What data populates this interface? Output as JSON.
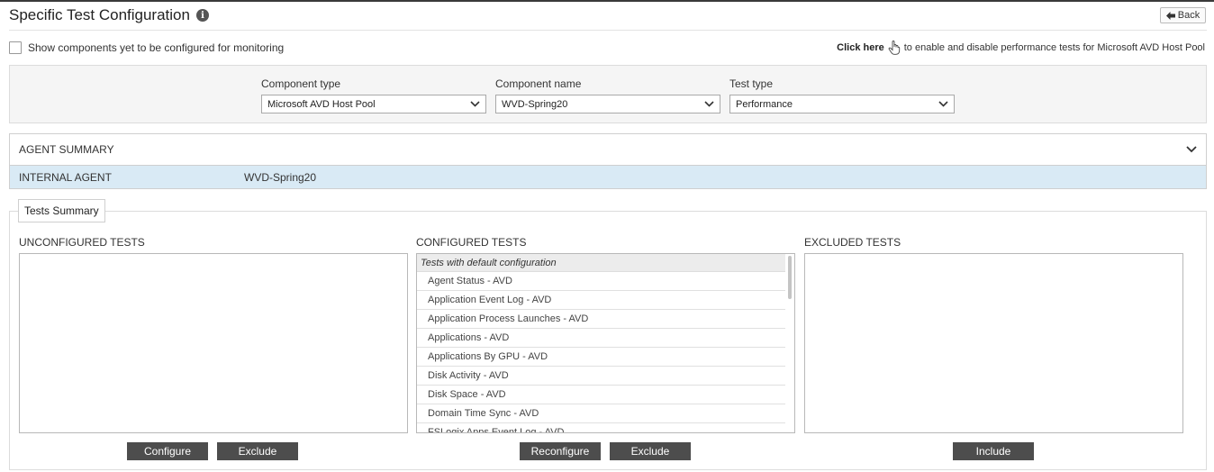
{
  "header": {
    "title": "Specific Test Configuration",
    "info_glyph": "i",
    "back_label": "Back"
  },
  "options": {
    "show_components_label": "Show components yet to be configured for monitoring",
    "show_components_checked": false,
    "click_here_label": "Click here",
    "click_here_text": "to enable and disable performance tests for Microsoft AVD Host Pool"
  },
  "filters": {
    "component_type": {
      "label": "Component type",
      "value": "Microsoft AVD Host Pool"
    },
    "component_name": {
      "label": "Component name",
      "value": "WVD-Spring20"
    },
    "test_type": {
      "label": "Test type",
      "value": "Performance"
    }
  },
  "agent_summary": {
    "title": "AGENT SUMMARY",
    "row": {
      "agent": "INTERNAL AGENT",
      "name": "WVD-Spring20"
    },
    "highlight_color": "#d9eaf5"
  },
  "tests_summary": {
    "tab_label": "Tests Summary",
    "unconfigured": {
      "title": "UNCONFIGURED TESTS",
      "items": [],
      "buttons": [
        "Configure",
        "Exclude"
      ]
    },
    "configured": {
      "title": "CONFIGURED TESTS",
      "group_header": "Tests with default configuration",
      "items": [
        "Agent Status - AVD",
        "Application Event Log - AVD",
        "Application Process Launches - AVD",
        "Applications - AVD",
        "Applications By GPU - AVD",
        "Disk Activity - AVD",
        "Disk Space - AVD",
        "Domain Time Sync - AVD",
        "FSLogix Apps Event Log - AVD"
      ],
      "buttons": [
        "Reconfigure",
        "Exclude"
      ]
    },
    "excluded": {
      "title": "EXCLUDED TESTS",
      "items": [],
      "buttons": [
        "Include"
      ]
    }
  },
  "colors": {
    "button_bg": "#4d4d4d",
    "panel_bg": "#f5f5f5"
  }
}
